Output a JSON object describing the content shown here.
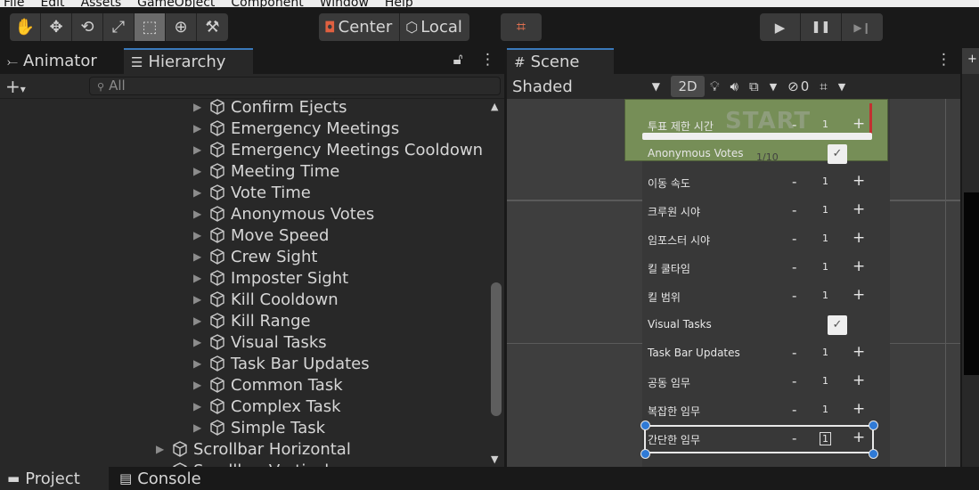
{
  "menu": [
    "File",
    "Edit",
    "Assets",
    "GameObject",
    "Component",
    "Window",
    "Help"
  ],
  "toolbar": {
    "tools": [
      {
        "name": "hand-tool-button",
        "icon": "✋"
      },
      {
        "name": "move-tool-button",
        "icon": "✥"
      },
      {
        "name": "rotate-tool-button",
        "icon": "⟲"
      },
      {
        "name": "scale-tool-button",
        "icon": "⤢"
      },
      {
        "name": "rect-tool-button",
        "icon": "⬚",
        "active": true
      },
      {
        "name": "transform-tool-button",
        "icon": "⊕"
      },
      {
        "name": "custom-tool-button",
        "icon": "⚒"
      }
    ],
    "pivot_label": "Center",
    "space_label": "Local",
    "grid_snap_icon": "⌗",
    "play_icon": "▶",
    "pause_icon": "❚❚",
    "step_icon": "▶❙"
  },
  "hierarchy": {
    "tabs": [
      {
        "label": "Animator",
        "icon": "⤚"
      },
      {
        "label": "Hierarchy",
        "icon": "☰"
      }
    ],
    "search_placeholder": "All",
    "items": [
      {
        "label": "Confirm Ejects",
        "depth": 2
      },
      {
        "label": "Emergency Meetings",
        "depth": 2
      },
      {
        "label": "Emergency Meetings Cooldown",
        "depth": 2
      },
      {
        "label": "Meeting Time",
        "depth": 2
      },
      {
        "label": "Vote Time",
        "depth": 2
      },
      {
        "label": "Anonymous Votes",
        "depth": 2
      },
      {
        "label": "Move Speed",
        "depth": 2
      },
      {
        "label": "Crew Sight",
        "depth": 2
      },
      {
        "label": "Imposter Sight",
        "depth": 2
      },
      {
        "label": "Kill Cooldown",
        "depth": 2
      },
      {
        "label": "Kill Range",
        "depth": 2
      },
      {
        "label": "Visual Tasks",
        "depth": 2
      },
      {
        "label": "Task Bar Updates",
        "depth": 2
      },
      {
        "label": "Common Task",
        "depth": 2
      },
      {
        "label": "Complex Task",
        "depth": 2
      },
      {
        "label": "Simple Task",
        "depth": 2
      },
      {
        "label": "Scrollbar Horizontal",
        "depth": 1
      },
      {
        "label": "Scrollbar Vertical",
        "depth": 1
      }
    ]
  },
  "scene": {
    "tab_label": "Scene",
    "shading_mode": "Shaded",
    "mode_2d": "2D",
    "hidden_count": "0",
    "start_label": "START",
    "counter": "1/10",
    "rows": [
      {
        "label": "투표 제한 시간",
        "type": "stepper",
        "value": "1"
      },
      {
        "label": "Anonymous Votes",
        "type": "toggle",
        "checked": "✓"
      },
      {
        "label": "이동 속도",
        "type": "stepper",
        "value": "1"
      },
      {
        "label": "크루원 시야",
        "type": "stepper",
        "value": "1"
      },
      {
        "label": "임포스터 시야",
        "type": "stepper",
        "value": "1"
      },
      {
        "label": "킬 쿨타임",
        "type": "stepper",
        "value": "1"
      },
      {
        "label": "킬 범위",
        "type": "stepper",
        "value": "1"
      },
      {
        "label": "Visual Tasks",
        "type": "toggle",
        "checked": "✓"
      },
      {
        "label": "Task Bar Updates",
        "type": "stepper",
        "value": "1"
      },
      {
        "label": "공동 임무",
        "type": "stepper",
        "value": "1"
      },
      {
        "label": "복잡한 임무",
        "type": "stepper",
        "value": "1"
      },
      {
        "label": "간단한 임무",
        "type": "stepper",
        "value": "1"
      }
    ],
    "minus_label": "-",
    "plus_label": "+"
  },
  "bottom": {
    "tabs": [
      {
        "label": "Project",
        "icon": "▬"
      },
      {
        "label": "Console",
        "icon": "▤"
      }
    ]
  }
}
